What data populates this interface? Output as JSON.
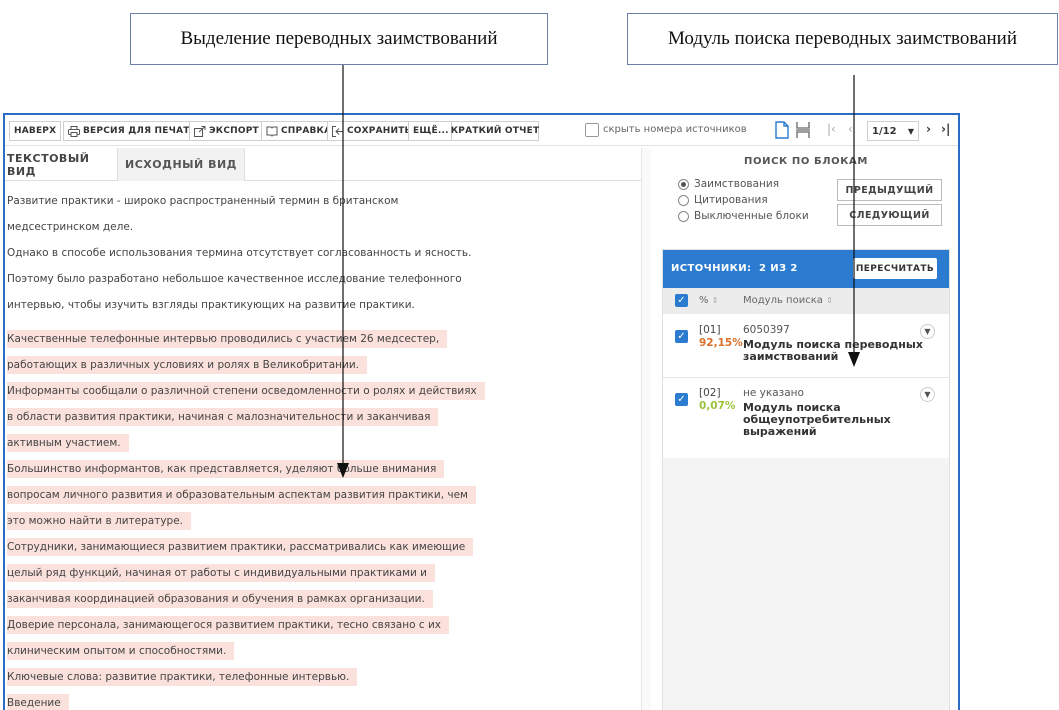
{
  "callouts": {
    "left": "Выделение переводных заимствований",
    "right": "Модуль поиска переводных заимствований"
  },
  "toolbar": {
    "top": "НАВЕРХ",
    "print": "ВЕРСИЯ ДЛЯ ПЕЧАТИ",
    "export": "ЭКСПОРТ",
    "help": "СПРАВКА",
    "save": "СОХРАНИТЬ",
    "more": "ЕЩЁ...",
    "short_report": "КРАТКИЙ ОТЧЕТ",
    "hide_numbers": "скрыть номера источников",
    "page": "1/12"
  },
  "tabs": {
    "text_view": "ТЕКСТОВЫЙ ВИД",
    "source_view": "ИСХОДНЫЙ ВИД"
  },
  "document": {
    "lines": [
      "Развитие практики - широко распространенный термин в британском",
      "медсестринском деле.",
      "Однако в способе использования термина отсутствует согласованность и ясность.",
      "Поэтому было разработано небольшое качественное исследование телефонного",
      "интервью, чтобы изучить взгляды практикующих на развитие практики.",
      "Качественные телефонные интервью проводились с участием 26 медсестер,",
      "работающих в различных условиях и ролях в Великобритании.",
      "Информанты сообщали о различной степени осведомленности о ролях и действиях",
      "в области развития практики, начиная с малозначительности и заканчивая",
      "активным участием.",
      "Большинство информантов, как представляется, уделяют больше внимания",
      "вопросам личного развития и образовательным аспектам развития практики, чем",
      "это можно найти в литературе.",
      "Сотрудники, занимающиеся развитием практики, рассматривались как имеющие",
      "целый ряд функций, начиная от работы с индивидуальными практиками и",
      "заканчивая координацией образования и обучения в рамках организации.",
      "Доверие персонала, занимающегося развитием практики, тесно связано с их",
      "клиническим опытом и способностями.",
      "Ключевые слова: развитие практики, телефонные интервью.",
      "Введение"
    ]
  },
  "block_search": {
    "title": "ПОИСК ПО БЛОКАМ",
    "options": [
      "Заимствования",
      "Цитирования",
      "Выключенные блоки"
    ],
    "selected": "Заимствования",
    "prev": "ПРЕДЫДУЩИЙ",
    "next": "СЛЕДУЮЩИЙ"
  },
  "sources": {
    "title": "ИСТОЧНИКИ:",
    "count": "2 ИЗ 2",
    "recalc": "ПЕРЕСЧИТАТЬ",
    "col_percent": "%",
    "col_module": "Модуль поиска",
    "items": [
      {
        "num": "[01]",
        "percent": "92,15%",
        "id": "6050397",
        "module": "Модуль поиска переводных заимствований",
        "percent_color": "#d9702a"
      },
      {
        "num": "[02]",
        "percent": "0,07%",
        "id": "не указано",
        "module": "Модуль поиска общеупотребительных выражений",
        "percent_color": "#9bc23c"
      }
    ]
  },
  "colors": {
    "accent": "#2b7bd0",
    "highlight": "#fbe1dc",
    "frame": "#2b6cc4"
  }
}
